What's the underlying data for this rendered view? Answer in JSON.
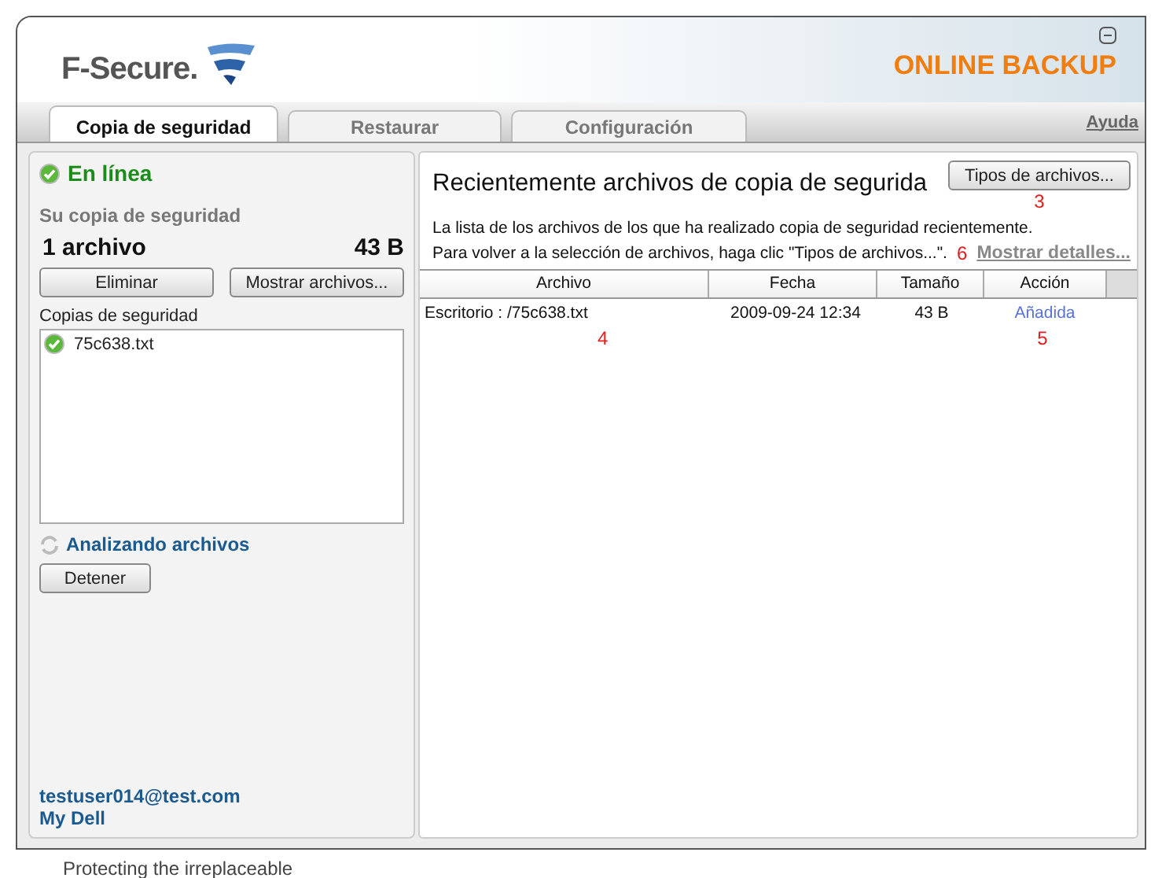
{
  "header": {
    "brand": "F-Secure.",
    "product": "ONLINE BACKUP"
  },
  "tabs": [
    {
      "label": "Copia de seguridad",
      "selected": true
    },
    {
      "label": "Restaurar",
      "selected": false
    },
    {
      "label": "Configuración",
      "selected": false
    }
  ],
  "help_link": "Ayuda",
  "left": {
    "status": "En línea",
    "backup_label": "Su copia de seguridad",
    "file_count": "1 archivo",
    "size": "43 B",
    "buttons": [
      "Eliminar",
      "Mostrar archivos..."
    ],
    "list_label": "Copias de seguridad",
    "items": [
      {
        "name": "75c638.txt"
      }
    ],
    "activity": "Analizando archivos",
    "stop_button": "Detener",
    "account": "testuser014@test.com",
    "account_link": "My Dell"
  },
  "right": {
    "title": "Recientemente archivos de copia de segurida",
    "types_button": "Tipos de archivos...",
    "types_note": "3",
    "description": "La lista de los archivos de los que ha realizado copia de seguridad recientemente.",
    "instruction": "Para volver a la selección de archivos, haga clic \"Tipos de archivos...\".",
    "details_note": "6",
    "details_link": "Mostrar detalles...",
    "table": {
      "columns": [
        "Archivo",
        "Fecha",
        "Tamaño",
        "Acción"
      ],
      "rows": [
        {
          "cells": [
            "Escritorio : /75c638.txt",
            "2009-09-24 12:34",
            "43 B",
            "Añadida"
          ]
        }
      ],
      "file_note": "4",
      "action_note": "5"
    }
  },
  "footer": "Protecting the irreplaceable"
}
